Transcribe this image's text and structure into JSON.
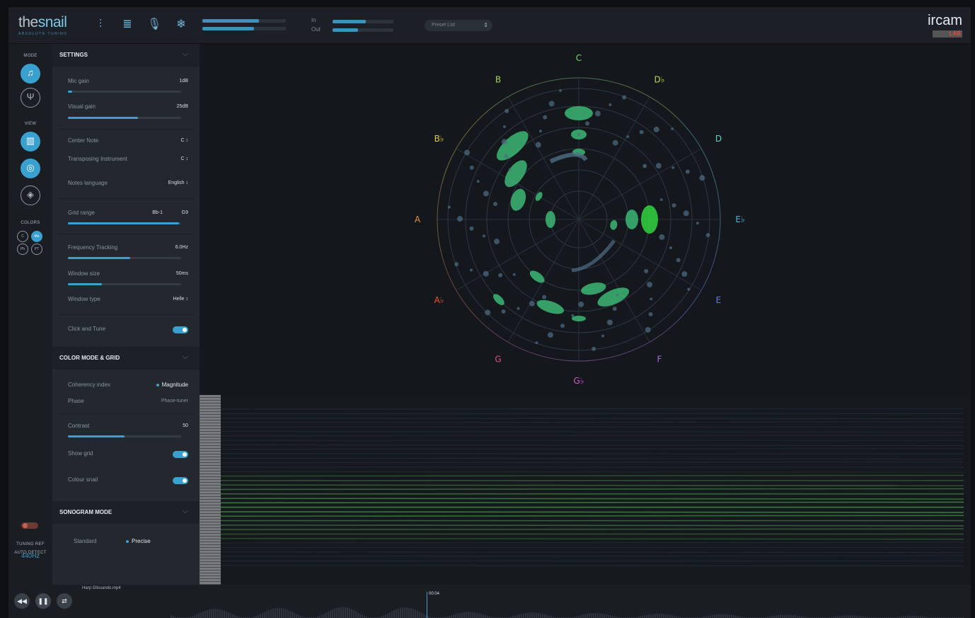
{
  "app": {
    "logo_the": "the",
    "logo_snail": "snail",
    "logo_sub": "ABSOLUTE TUNING",
    "brand": "ircam",
    "brand_lab": "LAB"
  },
  "topbar": {
    "icons": [
      "mixer-icon",
      "list-icon",
      "mic-icon",
      "snowflake-icon"
    ],
    "in_label": "In",
    "out_label": "Out",
    "preset_placeholder": "Preset List",
    "input_level": 0.55,
    "output_level": 0.42
  },
  "strip": {
    "mode_label": "MODE",
    "view_label": "VIEW",
    "colors_label": "COLORS",
    "color_options": [
      "C",
      "Ma",
      "Ph",
      "PT"
    ],
    "auto_detect_label": "AUTO DETECT",
    "tuning_ref_label": "TUNING REF",
    "tuning_ref_value": "440Hz"
  },
  "settings": {
    "title": "SETTINGS",
    "mic_gain_label": "Mic gain",
    "mic_gain_value": "1dB",
    "mic_gain_level": 0.04,
    "visual_gain_label": "Visual gain",
    "visual_gain_value": "25dB",
    "visual_gain_level": 0.62,
    "center_note_label": "Center Note",
    "center_note_value": "C ↕",
    "transposing_label": "Transposing Instrument",
    "transposing_value": "C ↕",
    "notes_language_label": "Notes language",
    "notes_language_value": "English ↕",
    "grid_range_label": "Grid range",
    "grid_range_low": "Bb-1",
    "grid_range_high": "G9",
    "grid_range_level": 0.98,
    "freq_tracking_label": "Frequency Tracking",
    "freq_tracking_value": "6.0Hz",
    "freq_tracking_level": 0.55,
    "window_size_label": "Window size",
    "window_size_value": "50ms",
    "window_size_level": 0.3,
    "window_type_label": "Window type",
    "window_type_value": "Helle ↕",
    "click_tune_label": "Click and Tune"
  },
  "color_mode": {
    "title": "COLOR MODE & GRID",
    "coherency_label": "Coherency index",
    "magnitude_label": "Magnitude",
    "phase_label": "Phase",
    "phase_value": "Phase-tuner",
    "contrast_label": "Contrast",
    "contrast_value": "50",
    "contrast_level": 0.5,
    "show_grid_label": "Show grid",
    "colour_snail_label": "Colour snail"
  },
  "sonogram": {
    "title": "SONOGRAM MODE",
    "standard_label": "Standard",
    "precise_label": "Precise"
  },
  "snail_notes": [
    {
      "note": "C",
      "color": "#7dd86b"
    },
    {
      "note": "D♭",
      "color": "#b8d84a"
    },
    {
      "note": "D",
      "color": "#5fd3c8"
    },
    {
      "note": "E♭",
      "color": "#4fb3e0"
    },
    {
      "note": "E",
      "color": "#5b7fe8"
    },
    {
      "note": "F",
      "color": "#a06ae0"
    },
    {
      "note": "G♭",
      "color": "#d058c8"
    },
    {
      "note": "G",
      "color": "#e05080"
    },
    {
      "note": "A♭",
      "color": "#e85a3a"
    },
    {
      "note": "A",
      "color": "#e8923a"
    },
    {
      "note": "B♭",
      "color": "#e8c83a"
    },
    {
      "note": "B",
      "color": "#a8d84a"
    }
  ],
  "transport": {
    "file_name": "Harp Glissando.mp4",
    "current_time": "00:04"
  }
}
